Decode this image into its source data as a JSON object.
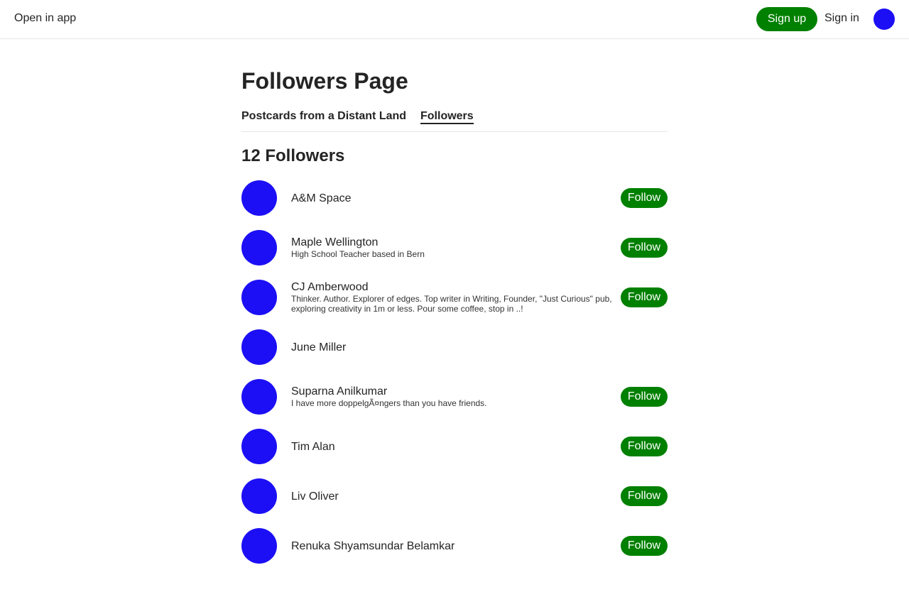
{
  "colors": {
    "accent": "#008000",
    "avatar": "#1c0ff5",
    "text": "#242424"
  },
  "header": {
    "open_in_app": "Open in app",
    "sign_up": "Sign up",
    "sign_in": "Sign in",
    "avatar_icon": "user-avatar-icon"
  },
  "page": {
    "title": "Followers Page",
    "tabs": [
      {
        "label": "Postcards from a Distant Land",
        "active": false
      },
      {
        "label": "Followers",
        "active": true
      }
    ],
    "followers_count": "12 Followers"
  },
  "followers": [
    {
      "name": "A&M Space",
      "bio": "",
      "follow_label": "Follow"
    },
    {
      "name": "Maple Wellington",
      "bio": "High School Teacher based in Bern",
      "follow_label": "Follow"
    },
    {
      "name": "CJ Amberwood",
      "bio": "Thinker. Author. Explorer of edges. Top writer in Writing, Founder, \"Just Curious\" pub, exploring creativity in 1m or less. Pour some coffee, stop in ..!",
      "follow_label": "Follow"
    },
    {
      "name": "June Miller",
      "bio": "",
      "follow_label": ""
    },
    {
      "name": "Suparna Anilkumar",
      "bio": "I have more doppelgÃ¤ngers than you have friends.",
      "follow_label": "Follow"
    },
    {
      "name": "Tim Alan",
      "bio": "",
      "follow_label": "Follow"
    },
    {
      "name": "Liv Oliver",
      "bio": "",
      "follow_label": "Follow"
    },
    {
      "name": "Renuka Shyamsundar Belamkar",
      "bio": "",
      "follow_label": "Follow"
    }
  ]
}
